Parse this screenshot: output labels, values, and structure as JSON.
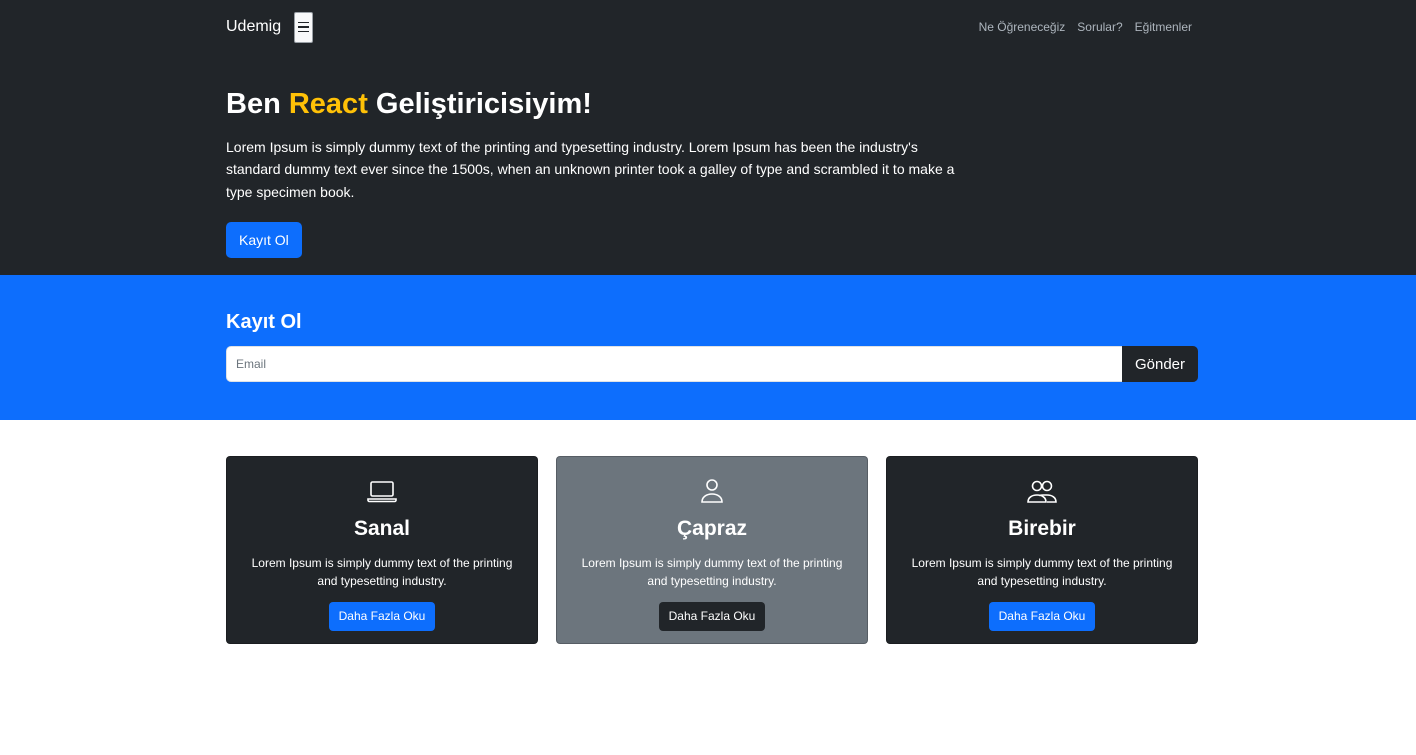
{
  "navbar": {
    "brand": "Udemig",
    "links": [
      "Ne Öğreneceğiz",
      "Sorular?",
      "Eğitmenler"
    ]
  },
  "hero": {
    "title_prefix": "Ben",
    "title_accent": "React",
    "title_suffix": "Geliştiricisiyim!",
    "description": "Lorem Ipsum is simply dummy text of the printing and typesetting industry. Lorem Ipsum has been the industry's standard dummy text ever since the 1500s, when an unknown printer took a galley of type and scrambled it to make a type specimen book.",
    "button_label": "Kayıt Ol"
  },
  "signup": {
    "title": "Kayıt Ol",
    "email_placeholder": "Email",
    "email_value": "",
    "submit_label": "Gönder"
  },
  "cards": [
    {
      "icon": "laptop-icon",
      "title": "Sanal",
      "text": "Lorem Ipsum is simply dummy text of the printing and typesetting industry.",
      "button_label": "Daha Fazla Oku"
    },
    {
      "icon": "person-icon",
      "title": "Çapraz",
      "text": "Lorem Ipsum is simply dummy text of the printing and typesetting industry.",
      "button_label": "Daha Fazla Oku"
    },
    {
      "icon": "people-icon",
      "title": "Birebir",
      "text": "Lorem Ipsum is simply dummy text of the printing and typesetting industry.",
      "button_label": "Daha Fazla Oku"
    }
  ],
  "colors": {
    "dark": "#212529",
    "primary": "#0d6efd",
    "accent": "#ffc107",
    "secondary": "#6c757d"
  }
}
